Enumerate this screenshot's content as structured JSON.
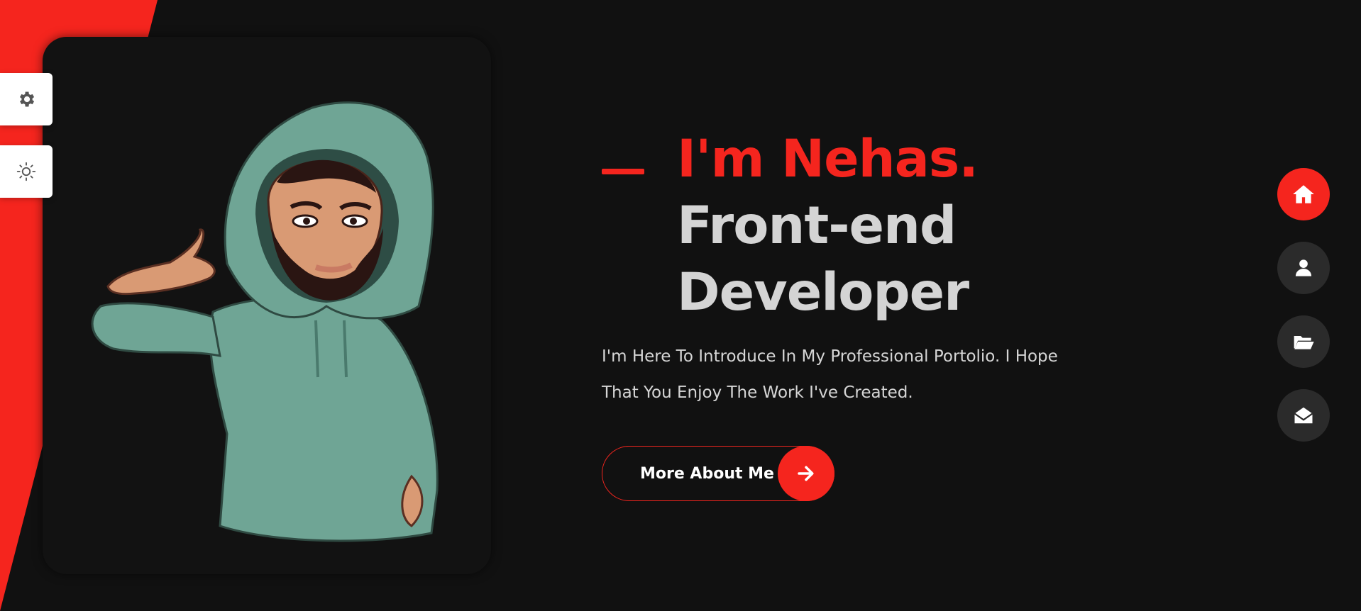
{
  "colors": {
    "accent": "#f5251e",
    "background": "#111111",
    "heading_light": "#d4d4d4",
    "text": "#d6d6d6",
    "nav_button": "#2b2b2b",
    "hoodie": "#6fa595"
  },
  "side_controls": {
    "settings_icon": "gear-icon",
    "theme_icon": "sun-icon"
  },
  "hero": {
    "name_line": "I'm Nehas.",
    "role_line_1": "Front-end",
    "role_line_2": "Developer",
    "description_line_1": "I'm Here To Introduce In My Professional Portolio. I Hope",
    "description_line_2": "That You Enjoy The Work I've Created.",
    "cta_label": "More About Me",
    "cta_icon": "arrow-right-icon"
  },
  "right_nav": {
    "items": [
      {
        "name": "home",
        "icon": "home-icon",
        "active": true
      },
      {
        "name": "about",
        "icon": "user-icon",
        "active": false
      },
      {
        "name": "portfolio",
        "icon": "folder-open-icon",
        "active": false
      },
      {
        "name": "contact",
        "icon": "envelope-open-icon",
        "active": false
      }
    ]
  }
}
